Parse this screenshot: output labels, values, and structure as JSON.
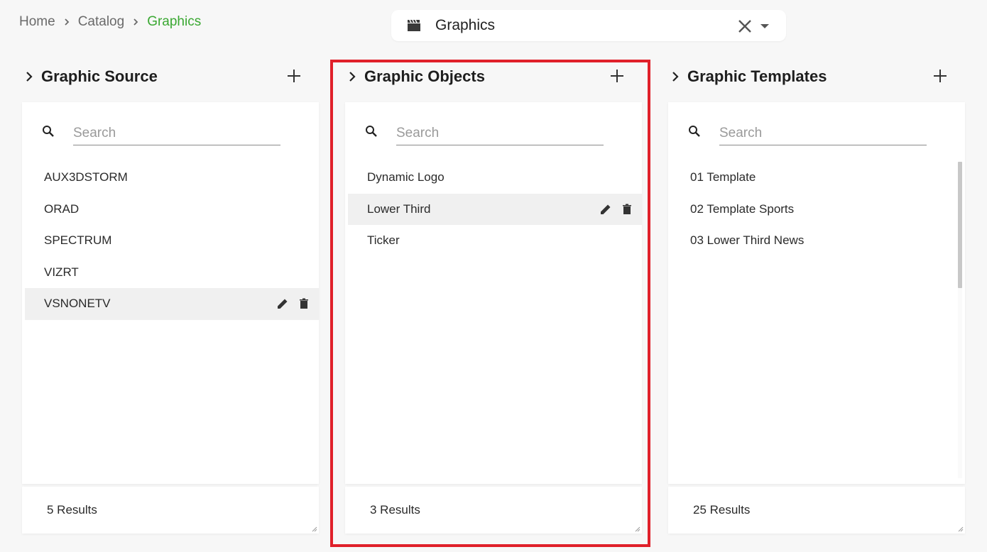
{
  "breadcrumb": {
    "items": [
      "Home",
      "Catalog"
    ],
    "current": "Graphics"
  },
  "selector": {
    "value": "Graphics",
    "icon": "clapperboard-icon"
  },
  "columns": [
    {
      "title": "Graphic Source",
      "search_placeholder": "Search",
      "items": [
        "AUX3DSTORM",
        "ORAD",
        "SPECTRUM",
        "VIZRT",
        "VSNONETV"
      ],
      "selected_index": 4,
      "results": "5 Results"
    },
    {
      "title": "Graphic Objects",
      "search_placeholder": "Search",
      "items": [
        "Dynamic Logo",
        "Lower Third",
        "Ticker"
      ],
      "selected_index": 1,
      "results": "3 Results"
    },
    {
      "title": "Graphic Templates",
      "search_placeholder": "Search",
      "items": [
        "01 Template",
        "02 Template Sports",
        "03 Lower Third News"
      ],
      "selected_index": -1,
      "results": "25 Results"
    }
  ],
  "colors": {
    "accent_green": "#3aa832",
    "highlight_red": "#e0202a",
    "background": "#f7f7f7"
  }
}
